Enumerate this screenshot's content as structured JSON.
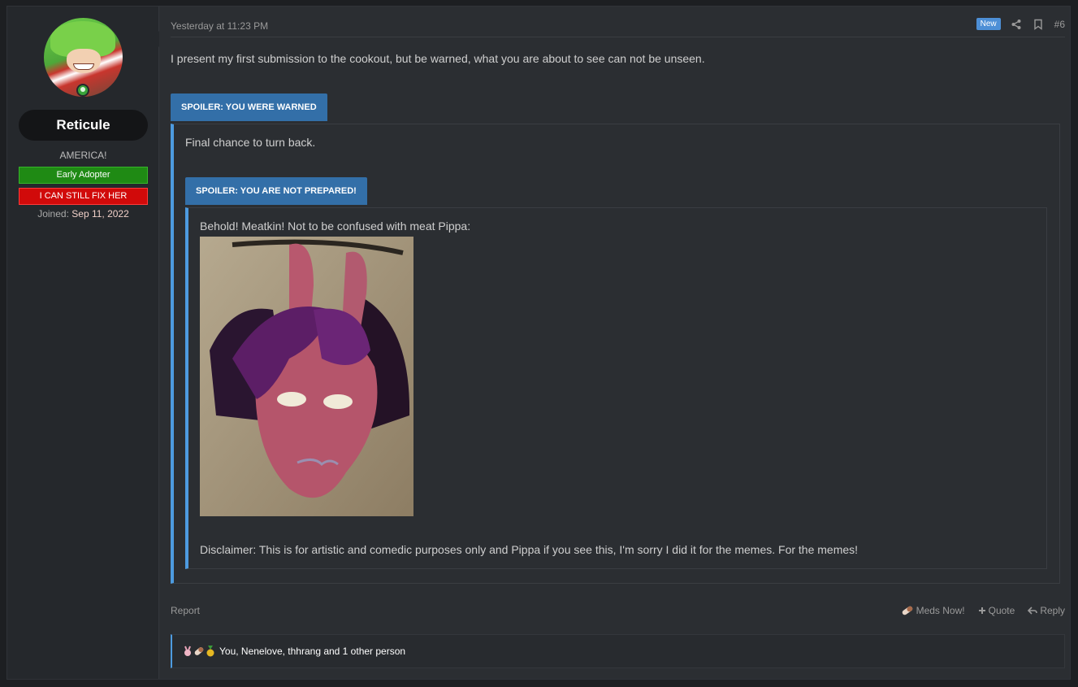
{
  "user": {
    "name": "Reticule",
    "title": "AMERICA!",
    "banners": [
      "Early Adopter",
      "I CAN STILL FIX HER"
    ],
    "joined_label": "Joined:",
    "joined_date": "Sep 11, 2022",
    "status": "online"
  },
  "post": {
    "time": "Yesterday at 11:23 PM",
    "badge": "New",
    "number": "#6",
    "header_icons": [
      "share-icon",
      "bookmark-icon"
    ],
    "body": "I present my first submission to the cookout, but be warned, what you are about to see can not be unseen.",
    "spoiler1": {
      "label": "SPOILER: YOU WERE WARNED",
      "text": "Final chance to turn back."
    },
    "spoiler2": {
      "label": "SPOILER: YOU ARE NOT PREPARED!",
      "text": "Behold! Meatkin! Not to be confused with meat Pippa:",
      "image_alt": "meat-sculpture-photo",
      "disclaimer": "Disclaimer: This is for artistic and comedic purposes only and Pippa if you see this, I'm sorry I did it for the memes. For the memes!"
    }
  },
  "footer": {
    "report": "Report",
    "meds": "Meds Now!",
    "quote": "Quote",
    "reply": "Reply"
  },
  "reactions": {
    "icons": [
      "pippa-icon",
      "pill-icon",
      "medal-icon"
    ],
    "text": "You, Nenelove, thhrang and 1 other person"
  },
  "colors": {
    "accent": "#336fa8",
    "quote_border": "#4d9be0",
    "badge_green": "#1f8a14",
    "badge_red": "#d10a0a"
  }
}
